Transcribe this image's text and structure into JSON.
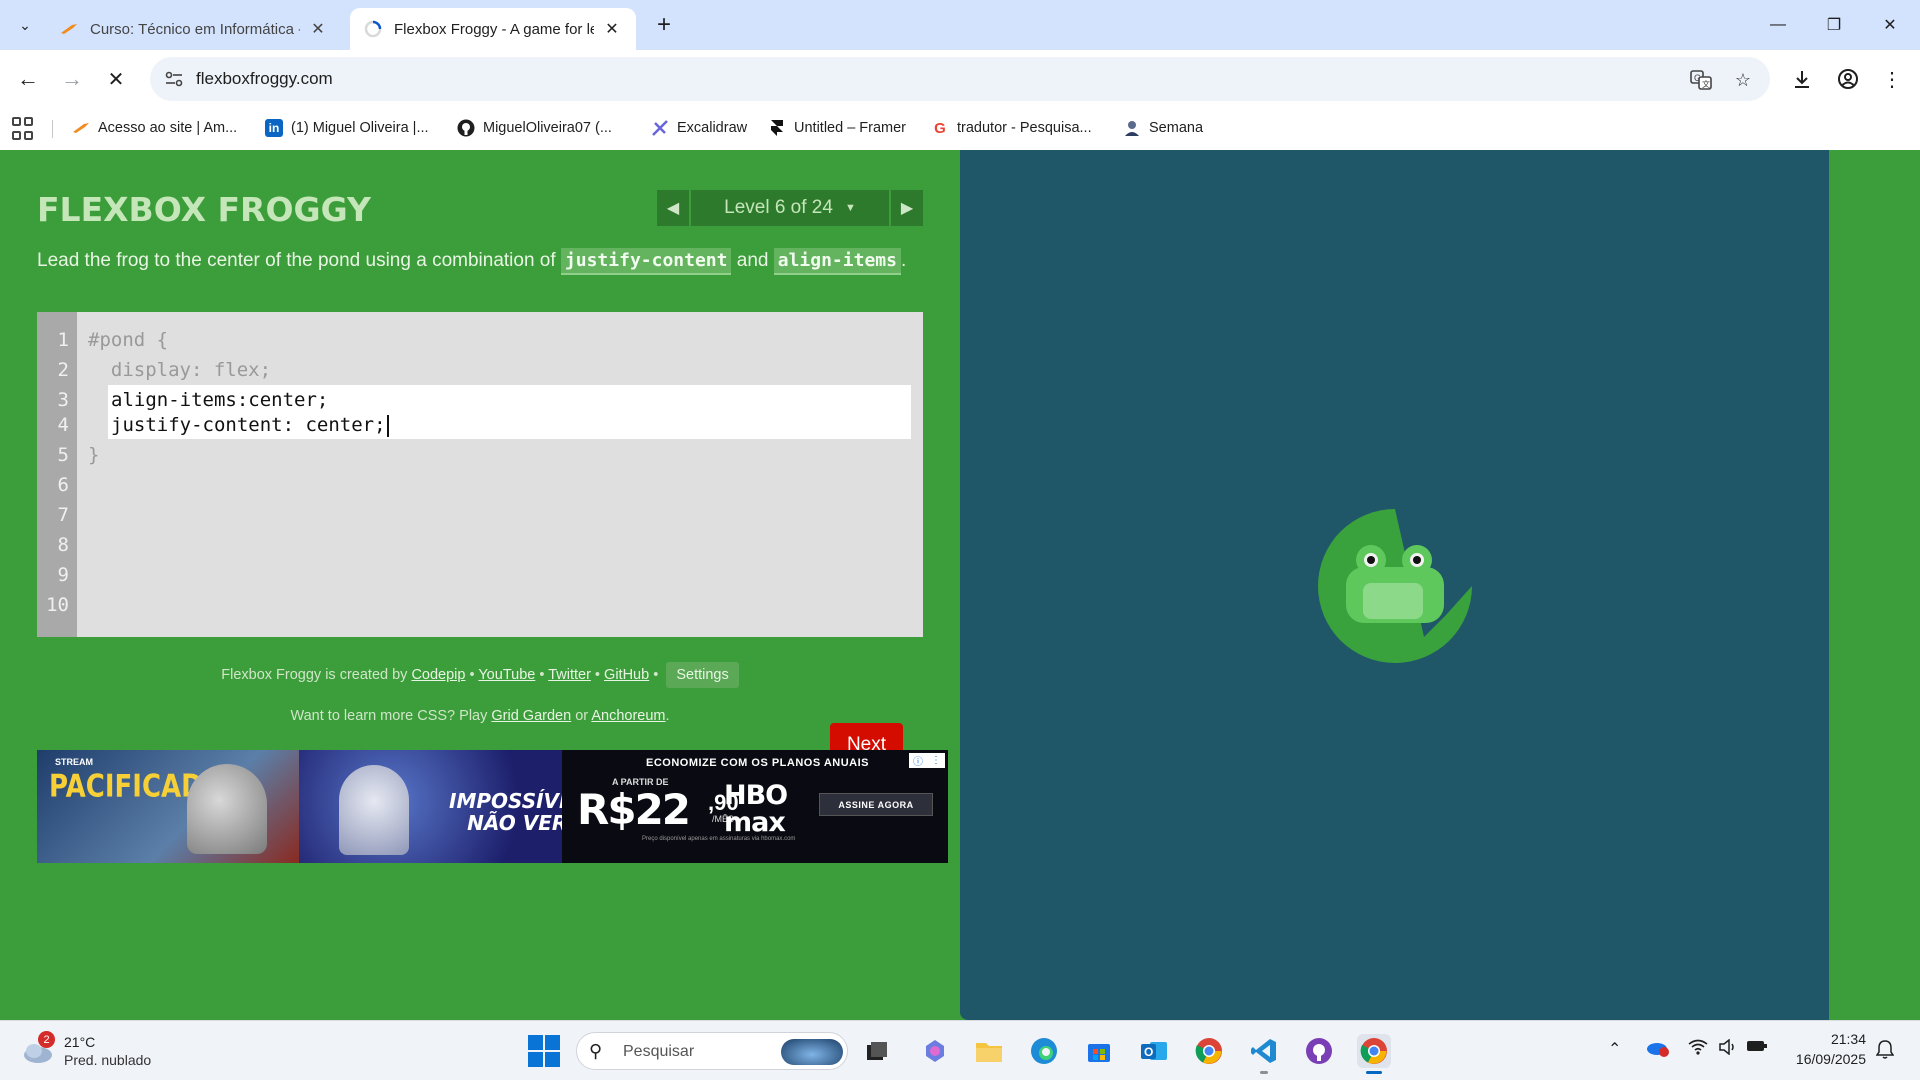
{
  "browser": {
    "tabs": [
      {
        "title": "Curso: Técnico em Informática -",
        "icon": "orange-bird-icon"
      },
      {
        "title": "Flexbox Froggy - A game for lea",
        "icon": "loading-spinner-icon"
      }
    ],
    "url": "flexboxfroggy.com",
    "bookmarks": [
      {
        "label": "Acesso ao site | Am...",
        "icon": "orange-bird-icon"
      },
      {
        "label": "(1) Miguel Oliveira |...",
        "icon": "linkedin-icon"
      },
      {
        "label": "MiguelOliveira07 (...",
        "icon": "github-icon"
      },
      {
        "label": "Excalidraw",
        "icon": "excalidraw-icon"
      },
      {
        "label": "Untitled – Framer",
        "icon": "framer-icon"
      },
      {
        "label": "tradutor - Pesquisa...",
        "icon": "google-icon"
      },
      {
        "label": "Semana",
        "icon": "person-icon"
      }
    ]
  },
  "game": {
    "logo": "FLEXBOX FROGGY",
    "level_label": "Level 6 of 24",
    "instruction_prefix": "Lead the frog to the center of the pond using a combination of ",
    "instruction_code1": "justify-content",
    "instruction_and": " and ",
    "instruction_code2": "align-items",
    "instruction_suffix": ".",
    "line_numbers": [
      "1",
      "2",
      "3",
      "4",
      "5",
      "6",
      "7",
      "8",
      "9",
      "10"
    ],
    "code_before": [
      "#pond {",
      "  display: flex;"
    ],
    "user_input": [
      "align-items:center;",
      "justify-content: center;"
    ],
    "code_after": "}",
    "next_button": "Next",
    "credits": {
      "prefix": "Flexbox Froggy is created by ",
      "codepip": "Codepip",
      "youtube": "YouTube",
      "twitter": "Twitter",
      "github": "GitHub",
      "bullet": " • ",
      "settings": "Settings"
    },
    "learn_more": {
      "prefix": "Want to learn more CSS? Play ",
      "grid_garden": "Grid Garden",
      "or": " or ",
      "anchoreum": "Anchoreum",
      "suffix": "."
    }
  },
  "ad": {
    "panel1_brand": "STREAM",
    "panel1_title": "PACIFICADOR",
    "panel2_title": "IMPOSSÍVEL NÃO VER",
    "panel3_top": "ECONOMIZE COM OS PLANOS ANUAIS",
    "panel3_from": "A PARTIR DE",
    "panel3_price": "R$22",
    "panel3_cents": ",90",
    "panel3_per": "/MÊS",
    "panel3_brand": "HBO max",
    "panel3_cta": "ASSINE AGORA",
    "panel3_fine": "Preço disponível apenas em assinaturas via hbomax.com"
  },
  "taskbar": {
    "weather_temp": "21°C",
    "weather_cond": "Pred. nublado",
    "weather_badge": "2",
    "search_placeholder": "Pesquisar",
    "time": "21:34",
    "date": "16/09/2025"
  },
  "colors": {
    "page_green": "#3c9d3b",
    "pond_blue": "#1f5768",
    "lilypad_green": "#3aa23c",
    "frog_green": "#8cd98a",
    "next_red": "#d40c00"
  }
}
